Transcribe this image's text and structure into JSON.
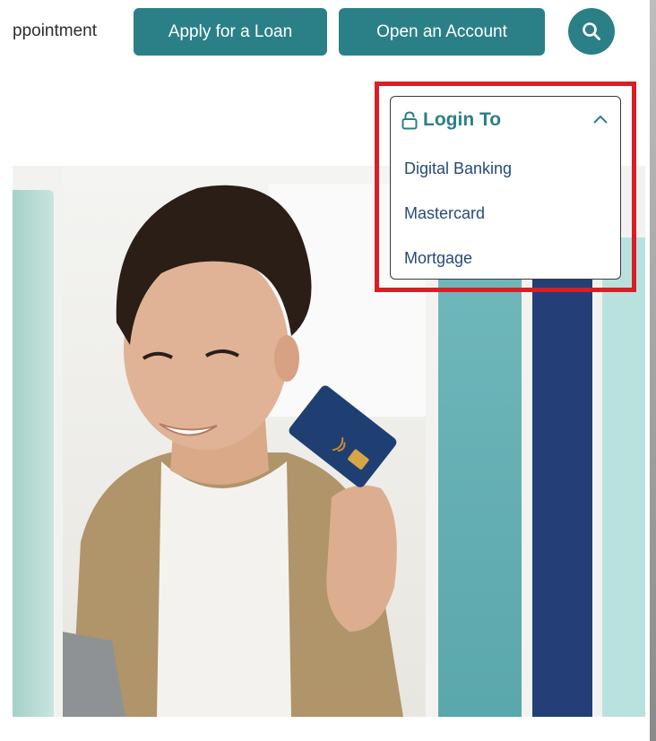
{
  "header": {
    "appointment_link": "ppointment",
    "apply_loan_label": "Apply for a Loan",
    "open_account_label": "Open an Account",
    "search_icon": "search-icon"
  },
  "login_menu": {
    "title": "Login To",
    "lock_icon": "lock-icon",
    "toggle_icon": "chevron-up-icon",
    "items": [
      {
        "label": "Digital Banking"
      },
      {
        "label": "Mastercard"
      },
      {
        "label": "Mortgage"
      }
    ]
  },
  "colors": {
    "brand_teal": "#2b8087",
    "title_teal": "#2b7f86",
    "navy": "#243f78",
    "highlight_red": "#d81f26",
    "light_teal": "#b9e2de"
  }
}
